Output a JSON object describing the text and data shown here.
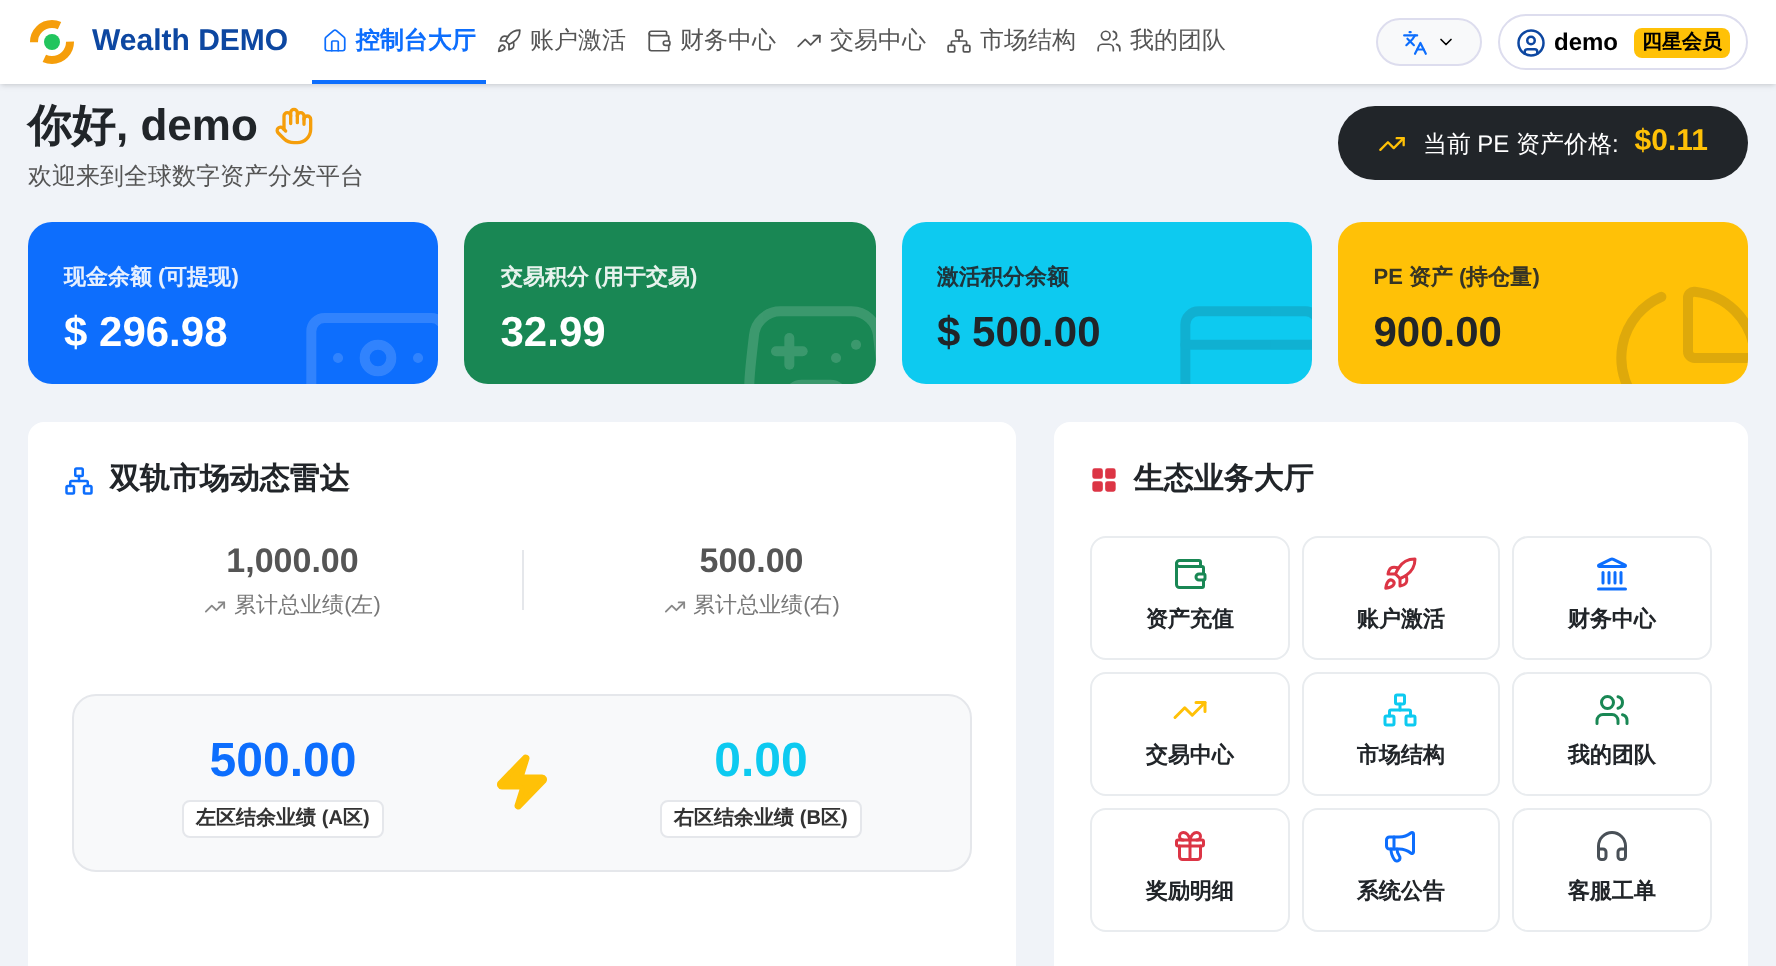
{
  "brand": {
    "name": "Wealth DEMO"
  },
  "nav": [
    {
      "label": "控制台大厅",
      "kind": "home",
      "selected": true
    },
    {
      "label": "账户激活",
      "kind": "rocket",
      "selected": false
    },
    {
      "label": "财务中心",
      "kind": "wallet",
      "selected": false
    },
    {
      "label": "交易中心",
      "kind": "chart",
      "selected": false
    },
    {
      "label": "市场结构",
      "kind": "network",
      "selected": false
    },
    {
      "label": "我的团队",
      "kind": "team",
      "selected": false
    }
  ],
  "user": {
    "name": "demo",
    "badge": "四星会员"
  },
  "greeting": {
    "title": "你好, demo",
    "subtitle": "欢迎来到全球数字资产分发平台"
  },
  "price": {
    "label": "当前 PE 资产价格:",
    "value": "$0.11"
  },
  "stats": [
    {
      "label": "现金余额 (可提现)",
      "value": "$ 296.98",
      "kind": "cash"
    },
    {
      "label": "交易积分 (用于交易)",
      "value": "32.99",
      "kind": "trade"
    },
    {
      "label": "激活积分余额",
      "value": "$ 500.00",
      "kind": "activate"
    },
    {
      "label": "PE 资产 (持仓量)",
      "value": "900.00",
      "kind": "pe"
    }
  ],
  "radar": {
    "title": "双轨市场动态雷达",
    "totals": [
      {
        "value": "1,000.00",
        "label": "累计总业绩(左)"
      },
      {
        "value": "500.00",
        "label": "累计总业绩(右)"
      }
    ],
    "balances": [
      {
        "value": "500.00",
        "label": "左区结余业绩 (A区)",
        "color": "#0d6efd"
      },
      {
        "value": "0.00",
        "label": "右区结余业绩 (B区)",
        "color": "#0dcaf0"
      }
    ]
  },
  "services": {
    "title": "生态业务大厅",
    "items": [
      {
        "label": "资产充值",
        "kind": "wallet"
      },
      {
        "label": "账户激活",
        "kind": "rocket"
      },
      {
        "label": "财务中心",
        "kind": "bank"
      },
      {
        "label": "交易中心",
        "kind": "chart"
      },
      {
        "label": "市场结构",
        "kind": "network"
      },
      {
        "label": "我的团队",
        "kind": "team"
      },
      {
        "label": "奖励明细",
        "kind": "gift"
      },
      {
        "label": "系统公告",
        "kind": "megaphone"
      },
      {
        "label": "客服工单",
        "kind": "headset"
      }
    ]
  }
}
